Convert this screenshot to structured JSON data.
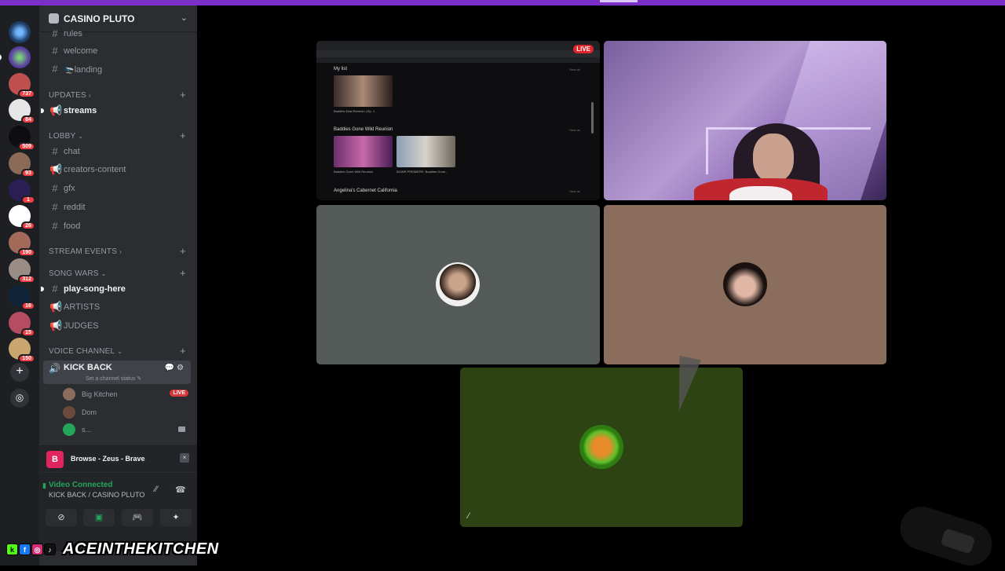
{
  "server": {
    "name": "CASINO PLUTO"
  },
  "server_rail": {
    "badges": [
      "737",
      "84",
      "509",
      "93",
      "1",
      "26",
      "190",
      "312",
      "16",
      "15",
      "150"
    ]
  },
  "channels": {
    "top": [
      {
        "name": "rules",
        "icon": "hash-icon"
      },
      {
        "name": "welcome",
        "icon": "hash-icon"
      },
      {
        "name": "🛬landing",
        "icon": "hash-icon"
      }
    ],
    "updates": {
      "label": "UPDATES",
      "items": [
        {
          "name": "streams",
          "icon": "megaphone-icon"
        }
      ]
    },
    "lobby": {
      "label": "LOBBY",
      "items": [
        {
          "name": "chat",
          "icon": "hash-icon"
        },
        {
          "name": "creators-content",
          "icon": "megaphone-icon"
        },
        {
          "name": "gfx",
          "icon": "hash-icon"
        },
        {
          "name": "reddit",
          "icon": "hash-icon"
        },
        {
          "name": "food",
          "icon": "hash-icon"
        }
      ]
    },
    "stream_events": {
      "label": "STREAM EVENTS"
    },
    "song_wars": {
      "label": "SONG WARS",
      "items": [
        {
          "name": "play-song-here",
          "icon": "hash-icon"
        },
        {
          "name": "ARTISTS",
          "icon": "megaphone-icon"
        },
        {
          "name": "JUDGES",
          "icon": "megaphone-icon"
        }
      ]
    },
    "voice_channel": {
      "label": "VOICE CHANNEL"
    }
  },
  "voice": {
    "name": "KICK BACK",
    "status_placeholder": "Set a channel status",
    "users": [
      {
        "name": "Big Kitchen",
        "badge": "LIVE"
      },
      {
        "name": "Dom"
      },
      {
        "name": "s..."
      }
    ]
  },
  "activity": {
    "title": "Browse - Zeus - Brave",
    "logo_letter": "B"
  },
  "rtc": {
    "status": "Video Connected",
    "location": "KICK BACK / CASINO PLUTO"
  },
  "screenshare": {
    "live_label": "LIVE",
    "section1": "My list",
    "section2": "Baddies Gone Wild Reunion",
    "section3": "Angelina's Cabernet California",
    "view_all": "View all",
    "cap1": "Baddies East Reunion | Ep. 1",
    "cap2": "Baddies Gone Wild Reunion",
    "cap3": "BGWR PREMIERE: Baddies Gone..."
  },
  "overlay": {
    "brand": "ACEINTHEKITCHEN",
    "socials": [
      "k",
      "f",
      "◎",
      "♪"
    ]
  },
  "colors": {
    "accent": "#7a2fc9",
    "sidebar": "#2b2d31",
    "rail": "#1e1f22",
    "tile_gray": "#535a58",
    "tile_tan": "#8a6d5c",
    "tile_green": "#2d4313",
    "connected_green": "#23a55a",
    "live_red": "#da373c"
  }
}
